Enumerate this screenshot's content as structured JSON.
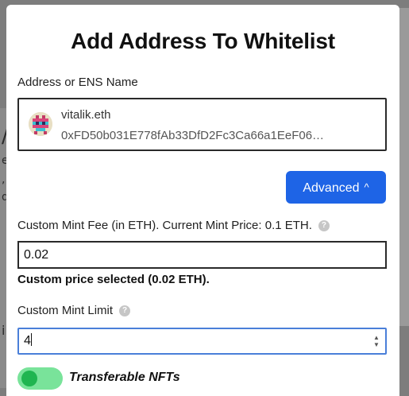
{
  "modal": {
    "title": "Add Address To Whitelist",
    "address_label": "Address or ENS Name",
    "ens_name": "vitalik.eth",
    "ens_address": "0xFD50b031E778fAb33DfD2Fc3Ca66a1EeF06…",
    "advanced_label": "Advanced",
    "advanced_caret": "^",
    "mint_fee_label": "Custom Mint Fee (in ETH). Current Mint Price: 0.1 ETH.",
    "mint_fee_value": "0.02",
    "custom_price_note": "Custom price selected (0.02 ETH).",
    "mint_limit_label": "Custom Mint Limit",
    "mint_limit_value": "4",
    "transferable_label": "Transferable NFTs",
    "transferable_on": true,
    "help_glyph": "?"
  },
  "background": {
    "glyphs": [
      "/",
      "e",
      ",",
      "d",
      "i"
    ]
  },
  "colors": {
    "accent": "#1e64e6",
    "toggle_track": "#79e39a",
    "toggle_knob": "#1fb550",
    "focus_border": "#4a7fd9"
  }
}
